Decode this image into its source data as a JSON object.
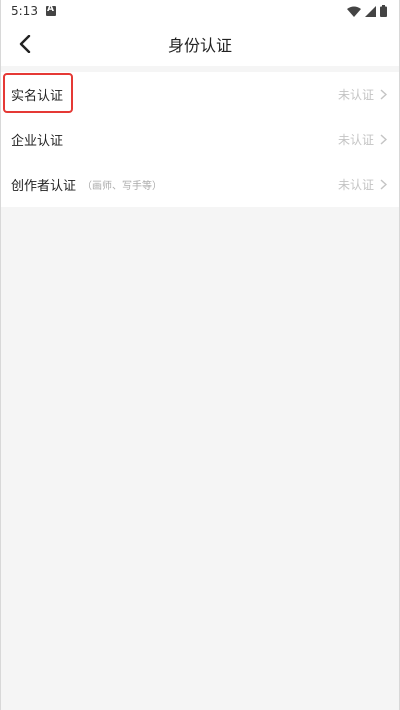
{
  "status_bar": {
    "time": "5:13"
  },
  "header": {
    "title": "身份认证",
    "back_icon": "chevron-left-icon"
  },
  "list": {
    "items": [
      {
        "label": "实名认证",
        "hint": "",
        "status": "未认证",
        "highlighted": true
      },
      {
        "label": "企业认证",
        "hint": "",
        "status": "未认证",
        "highlighted": false
      },
      {
        "label": "创作者认证",
        "hint": "（画师、写手等）",
        "status": "未认证",
        "highlighted": false
      }
    ]
  },
  "colors": {
    "highlight_border": "#e53935",
    "page_background": "#f5f5f5",
    "status_text": "#c4c4c4"
  }
}
